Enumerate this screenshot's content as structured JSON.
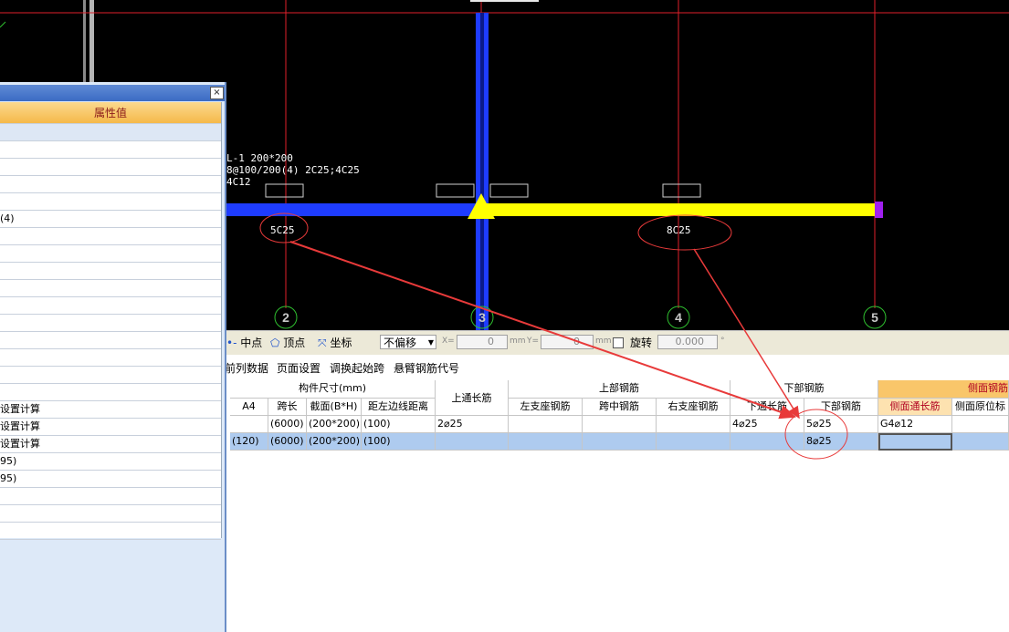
{
  "cad": {
    "beam_label_line1": "L-1 200*200",
    "beam_label_line2": "8@100/200(4) 2C25;4C25",
    "beam_label_line3": "4C12",
    "annot_left": "5C25",
    "annot_right": "8C25",
    "axis_numbers": [
      "2",
      "3",
      "4",
      "5"
    ]
  },
  "snapbar": {
    "midpoint": "中点",
    "vertex": "顶点",
    "coordinate": "坐标",
    "offset_mode": "不偏移",
    "x_label": "X=",
    "x_value": "0",
    "y_label": "Y=",
    "y_value": "0",
    "mm1": "mm",
    "mm2": "mm",
    "rotate": "旋转",
    "rotate_value": "0.000",
    "degree": "°"
  },
  "menubar": [
    "前列数据",
    "页面设置",
    "调换起始跨",
    "悬臂钢筋代号"
  ],
  "grid": {
    "group_size": "构件尺寸(mm)",
    "top_through": "上通长筋",
    "group_top": "上部钢筋",
    "group_bottom": "下部钢筋",
    "group_side": "侧面钢筋",
    "cols": [
      "A4",
      "跨长",
      "截面(B*H)",
      "距左边线距离",
      "左支座钢筋",
      "跨中钢筋",
      "右支座钢筋",
      "下通长筋",
      "下部钢筋",
      "侧面通长筋",
      "侧面原位标"
    ],
    "row1": [
      "",
      "(6000)",
      "(200*200)",
      "(100)",
      "2⌀25",
      "",
      "",
      "",
      "4⌀25",
      "5⌀25",
      "G4⌀12",
      ""
    ],
    "row2": [
      "(120)",
      "(6000)",
      "(200*200)",
      "(100)",
      "",
      "",
      "",
      "",
      "",
      "8⌀25",
      "",
      ""
    ]
  },
  "panel": {
    "header": "属性值",
    "close": "×",
    "rows": [
      "",
      "",
      "",
      "",
      "",
      "(4)",
      "",
      "",
      "",
      "",
      "",
      "",
      "",
      "",
      "",
      "",
      "设置计算",
      "设置计算",
      "设置计算",
      "95)",
      "95)",
      "",
      "",
      ""
    ]
  },
  "colors": {
    "beam_blue": "#1e3cff",
    "beam_yellow": "#ffff00",
    "axis_red": "#e0202a",
    "arrow_red": "#e83a3a"
  }
}
